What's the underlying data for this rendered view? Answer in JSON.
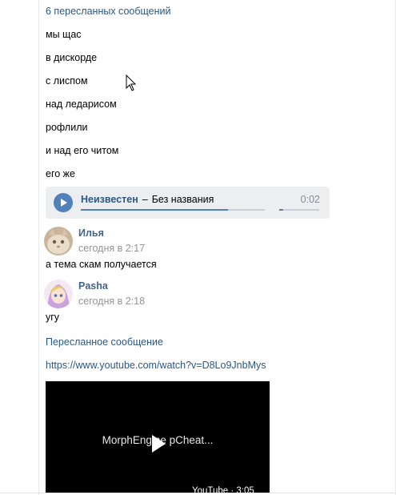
{
  "forwarded_header": "6 пересланных сообщений",
  "messages": [
    "мы щас",
    "в дискорде",
    "с лиспом",
    "над ледарисом",
    "рофлили",
    "и над его читом",
    "его же"
  ],
  "audio": {
    "artist": "Неизвестен",
    "separator": "–",
    "title": "Без названия",
    "time": "0:02",
    "progress": 0.8,
    "volume": 0.1
  },
  "posts": [
    {
      "author": "Илья",
      "time": "сегодня в 2:17",
      "text": "а тема скам получается"
    },
    {
      "author": "Pasha",
      "time": "сегодня в 2:18",
      "text": "угу"
    }
  ],
  "forwarded_single": "Пересланное сообщение",
  "url": "https://www.youtube.com/watch?v=D8Lo9JnbMys",
  "video": {
    "title": "MorphEngine pCheat...",
    "badge": "YouTube · 3:05"
  }
}
